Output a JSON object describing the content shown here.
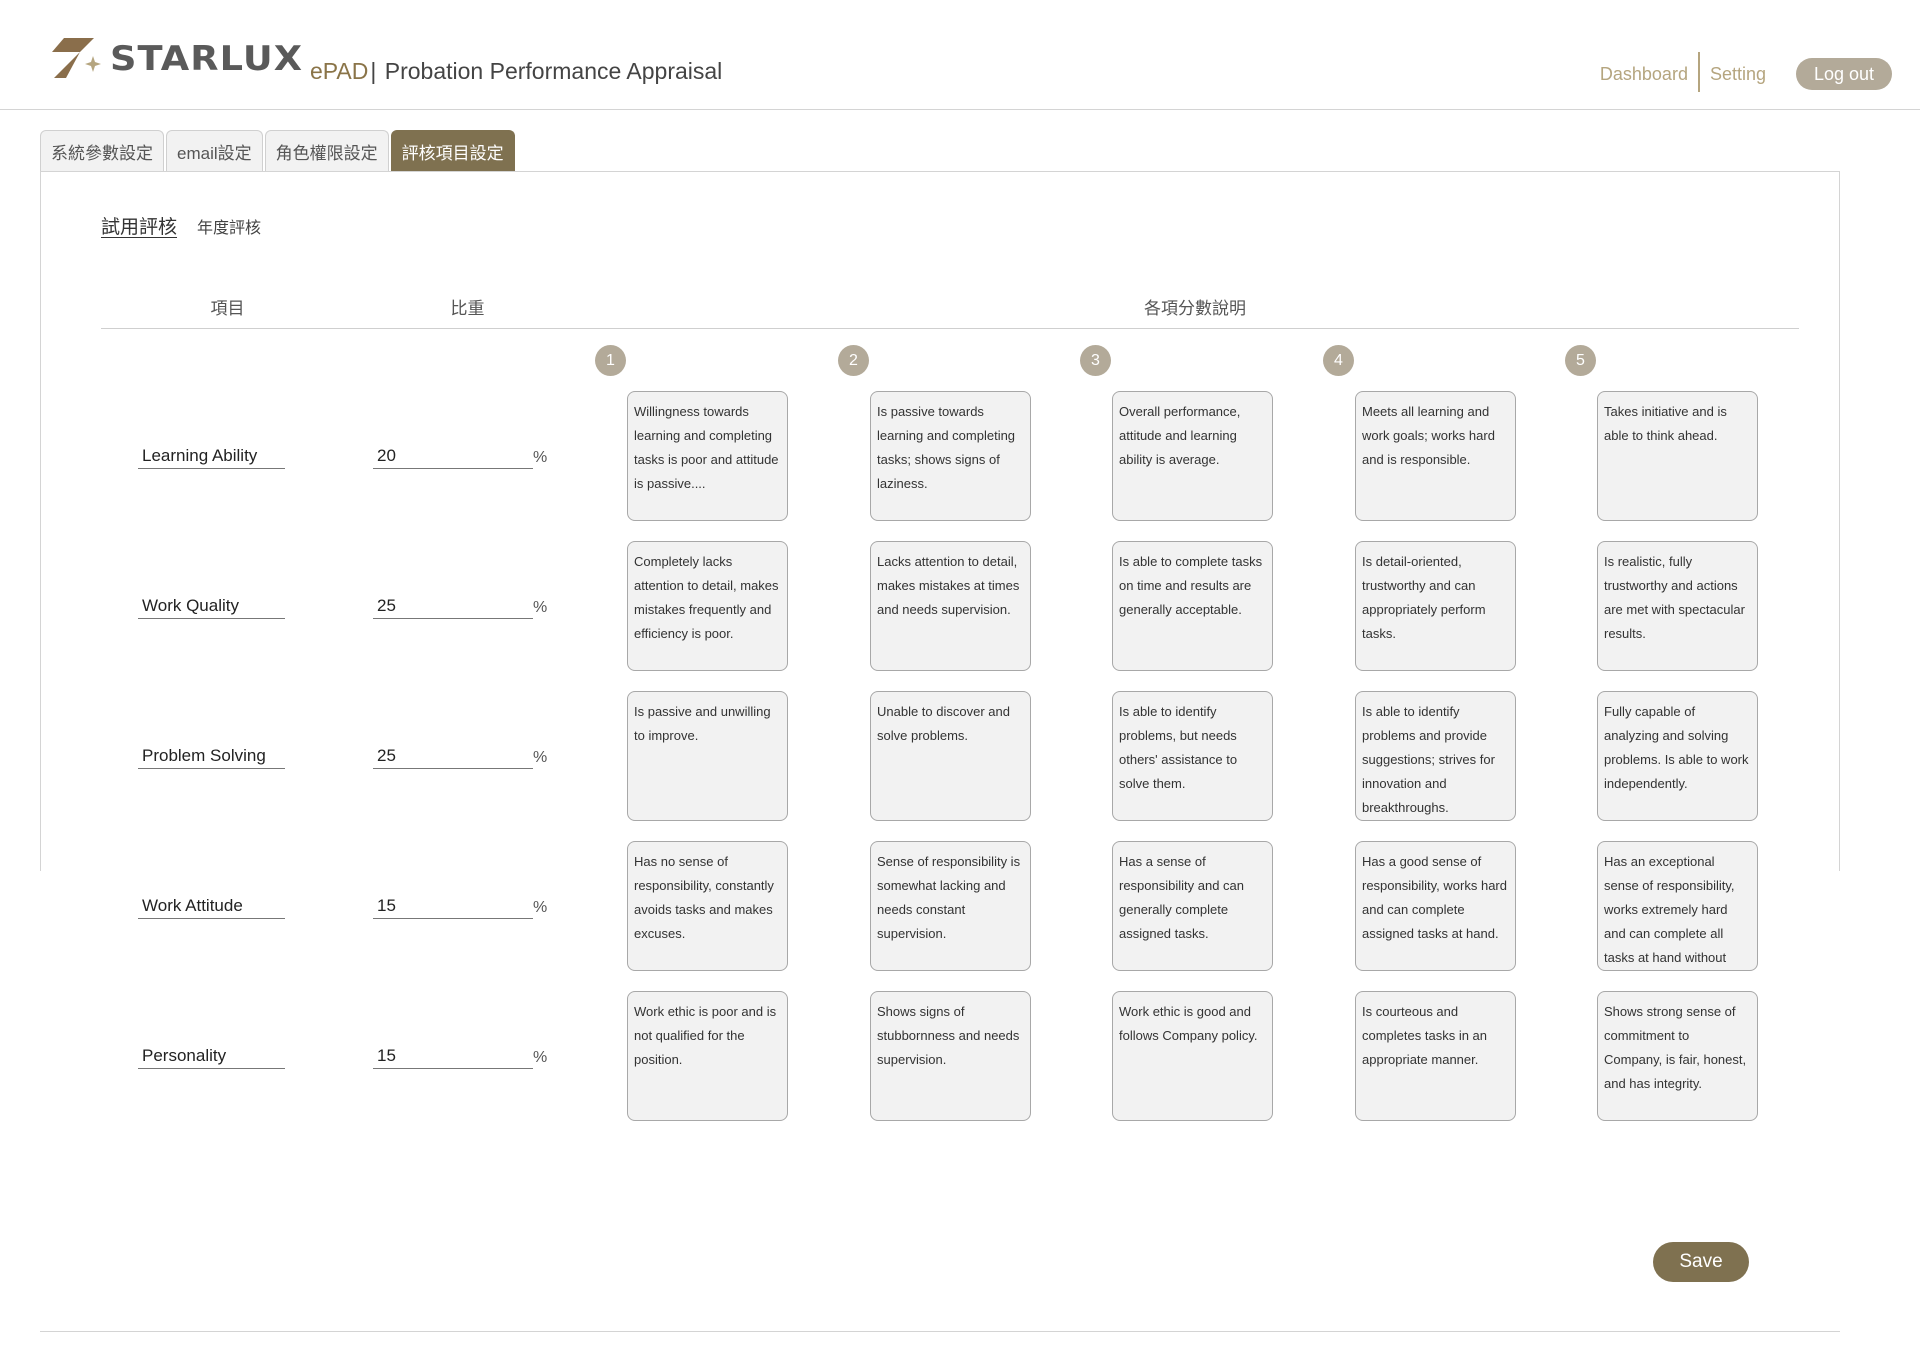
{
  "header": {
    "logo_text": "STARLUX",
    "app_brand": "ePAD",
    "app_separator": "|",
    "app_title": "Probation Performance Appraisal",
    "nav": {
      "dashboard": "Dashboard",
      "setting": "Setting",
      "logout": "Log out"
    }
  },
  "tabs": [
    "系統參數設定",
    "email設定",
    "角色權限設定",
    "評核項目設定"
  ],
  "active_tab": "評核項目設定",
  "subtabs": [
    "試用評核",
    "年度評核"
  ],
  "active_subtab": "試用評核",
  "table": {
    "headers": {
      "item": "項目",
      "weight": "比重",
      "description": "各項分數說明"
    },
    "scores": [
      "1",
      "2",
      "3",
      "4",
      "5"
    ],
    "percent_sign": "%",
    "rows": [
      {
        "item": "Learning Ability",
        "weight": "20",
        "descriptions": [
          "Willingness towards learning and completing tasks is poor and attitude is passive....",
          "Is passive towards learning and completing tasks; shows signs of laziness.",
          "Overall performance, attitude and learning ability is average.",
          "Meets all learning and work goals; works hard and is responsible.",
          "Takes initiative and is able to think ahead."
        ]
      },
      {
        "item": "Work Quality",
        "weight": "25",
        "descriptions": [
          "Completely lacks attention to detail, makes mistakes frequently and efficiency is poor.",
          "Lacks attention to detail, makes mistakes at times and needs supervision.",
          "Is able to complete tasks on time and results are generally acceptable.",
          "Is detail-oriented, trustworthy and can appropriately perform tasks.",
          "Is realistic, fully trustworthy and actions are met with spectacular results."
        ]
      },
      {
        "item": "Problem Solving",
        "weight": "25",
        "descriptions": [
          "Is passive and unwilling to improve.",
          "Unable to discover and solve problems.",
          "Is able to identify problems, but needs others' assistance to solve them.",
          "Is able to identify problems and provide suggestions; strives for innovation and breakthroughs.",
          "Fully capable of analyzing and solving problems. Is able to work independently."
        ]
      },
      {
        "item": "Work Attitude",
        "weight": "15",
        "descriptions": [
          "Has no sense of responsibility, constantly avoids tasks and makes excuses.",
          "Sense of responsibility is somewhat lacking and needs constant supervision.",
          "Has a sense of responsibility and can generally complete assigned tasks.",
          "Has a good sense of responsibility, works hard and can complete assigned tasks at hand.",
          "Has an exceptional sense of responsibility, works extremely hard and can complete all tasks at hand without"
        ]
      },
      {
        "item": "Personality",
        "weight": "15",
        "descriptions": [
          "Work ethic is poor and is not qualified for the position.",
          "Shows signs of stubbornness and needs supervision.",
          "Work ethic is good and follows Company policy.",
          "Is courteous and completes tasks in an appropriate manner.",
          "Shows strong sense of commitment to Company, is fair, honest, and has integrity."
        ]
      }
    ]
  },
  "save_label": "Save",
  "colors": {
    "accent": "#7f7150",
    "accent_light": "#b3aa99",
    "link": "#b5a57f",
    "logo_mark": "#8a6e4b"
  },
  "icons": {
    "logo": "starlux-star-logo",
    "score_marker": "numbered-circle"
  }
}
